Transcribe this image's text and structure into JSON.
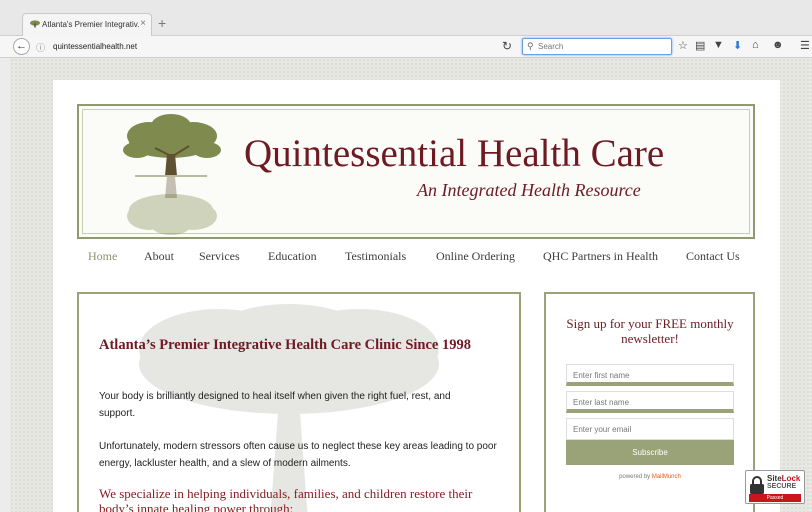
{
  "browser": {
    "tab_title": "Atlanta's Premier Integrativ...",
    "tab_close": "×",
    "new_tab": "+",
    "url": "quintessentialhealth.net",
    "search_placeholder": "Search"
  },
  "header": {
    "title": "Quintessential Health Care",
    "tagline": "An Integrated Health Resource"
  },
  "nav": {
    "items": [
      "Home",
      "About",
      "Services",
      "Education",
      "Testimonials",
      "Online Ordering",
      "QHC Partners in Health",
      "Contact Us"
    ],
    "active": "Home"
  },
  "content": {
    "heading": "Atlanta’s Premier Integrative Health Care Clinic Since 1998",
    "p1": "Your body is brilliantly designed to heal itself when given the right fuel, rest, and support.",
    "p2": "Unfortunately, modern stressors often cause us to neglect these key areas leading to poor energy, lackluster health, and a slew of modern ailments.",
    "p3": "We specialize in helping individuals, families, and children restore their body’s innate healing power through:"
  },
  "newsletter": {
    "title": "Sign up for your FREE monthly newsletter!",
    "first_name_placeholder": "Enter first name",
    "last_name_placeholder": "Enter last name",
    "email_placeholder": "Enter your email",
    "subscribe_label": "Subscribe",
    "powered_prefix": "powered by ",
    "powered_brand": "MailMunch"
  },
  "sitelock": {
    "site": "Site",
    "lock": "Lock",
    "secure": "SECURE",
    "passed": "Passed"
  },
  "colors": {
    "brand_maroon": "#6d1a22",
    "olive_border": "#9aa277",
    "nav_active": "#8d9170"
  }
}
